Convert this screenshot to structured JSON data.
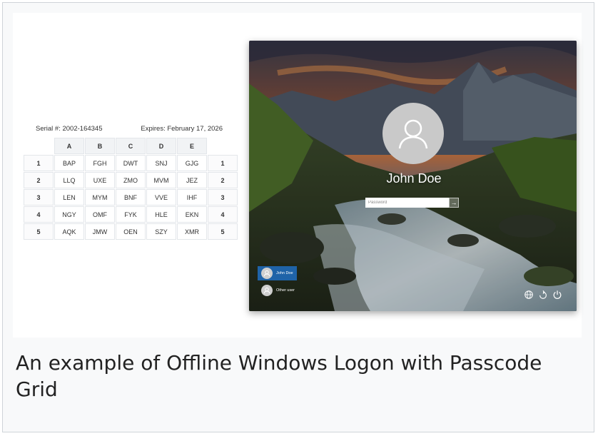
{
  "grid": {
    "serial_label": "Serial #: 2002-164345",
    "expires_label": "Expires: February 17, 2026",
    "columns": [
      "A",
      "B",
      "C",
      "D",
      "E"
    ],
    "rows": [
      {
        "num": "1",
        "cells": [
          "BAP",
          "FGH",
          "DWT",
          "SNJ",
          "GJG"
        ]
      },
      {
        "num": "2",
        "cells": [
          "LLQ",
          "UXE",
          "ZMO",
          "MVM",
          "JEZ"
        ]
      },
      {
        "num": "3",
        "cells": [
          "LEN",
          "MYM",
          "BNF",
          "VVE",
          "IHF"
        ]
      },
      {
        "num": "4",
        "cells": [
          "NGY",
          "OMF",
          "FYK",
          "HLE",
          "EKN"
        ]
      },
      {
        "num": "5",
        "cells": [
          "AQK",
          "JMW",
          "OEN",
          "SZY",
          "XMR"
        ]
      }
    ]
  },
  "logon": {
    "user_name": "John Doe",
    "password_placeholder": "Password",
    "submit_symbol": "→",
    "users": [
      {
        "name": "John Doe",
        "active": true
      },
      {
        "name": "Other user",
        "active": false
      }
    ],
    "icons": [
      "network-icon",
      "accessibility-icon",
      "power-icon"
    ]
  },
  "caption": "An example of Offline Windows Logon with Passcode Grid"
}
